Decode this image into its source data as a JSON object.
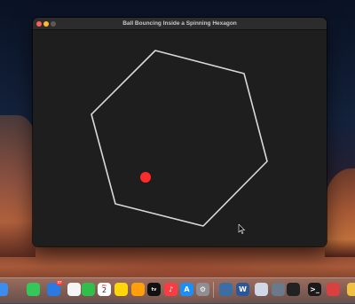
{
  "window": {
    "title": "Ball Bouncing Inside a Spinning Hexagon"
  },
  "scene": {
    "shape": "hexagon",
    "stroke_color": "#d9d9d9",
    "background_color": "#1e1e1e",
    "ball_color": "#ff2a2a"
  },
  "dock": {
    "apps": [
      {
        "icon": "finder-icon",
        "color": "#3d8df0"
      },
      {
        "icon": "messages-icon",
        "color": "#34c759"
      },
      {
        "icon": "mail-icon",
        "color": "#2a7ae2",
        "badge": "37"
      },
      {
        "icon": "photos-icon",
        "color": "#f5f5f5"
      },
      {
        "icon": "facetime-icon",
        "color": "#2fbf4a"
      },
      {
        "icon": "calendar-icon",
        "color": "#ffffff",
        "month": "JUL",
        "day": "2"
      },
      {
        "icon": "notes-icon",
        "color": "#ffd60a"
      },
      {
        "icon": "pages-icon",
        "color": "#ff9f0a"
      },
      {
        "icon": "apple-tv-icon",
        "color": "#111111",
        "glyph": "tv"
      },
      {
        "icon": "music-icon",
        "color": "#fc3c44",
        "glyph": "♪"
      },
      {
        "icon": "app-store-icon",
        "color": "#1c8ef9",
        "glyph": "A"
      },
      {
        "icon": "system-settings-icon",
        "color": "#8e8e93",
        "glyph": "⚙"
      },
      {
        "icon": "python-icon",
        "color": "#3a6ea5"
      },
      {
        "icon": "word-icon",
        "color": "#2b579a",
        "glyph": "W"
      },
      {
        "icon": "preview-icon",
        "color": "#d0d8e8"
      },
      {
        "icon": "display-icon",
        "color": "#6a7a8a"
      },
      {
        "icon": "activity-monitor-icon",
        "color": "#222222"
      },
      {
        "icon": "terminal-icon",
        "color": "#1a1a1a",
        "glyph": ">_"
      },
      {
        "icon": "photo-booth-icon",
        "color": "#d94040"
      },
      {
        "icon": "preview-viewer-icon",
        "color": "#f0c040"
      }
    ]
  }
}
